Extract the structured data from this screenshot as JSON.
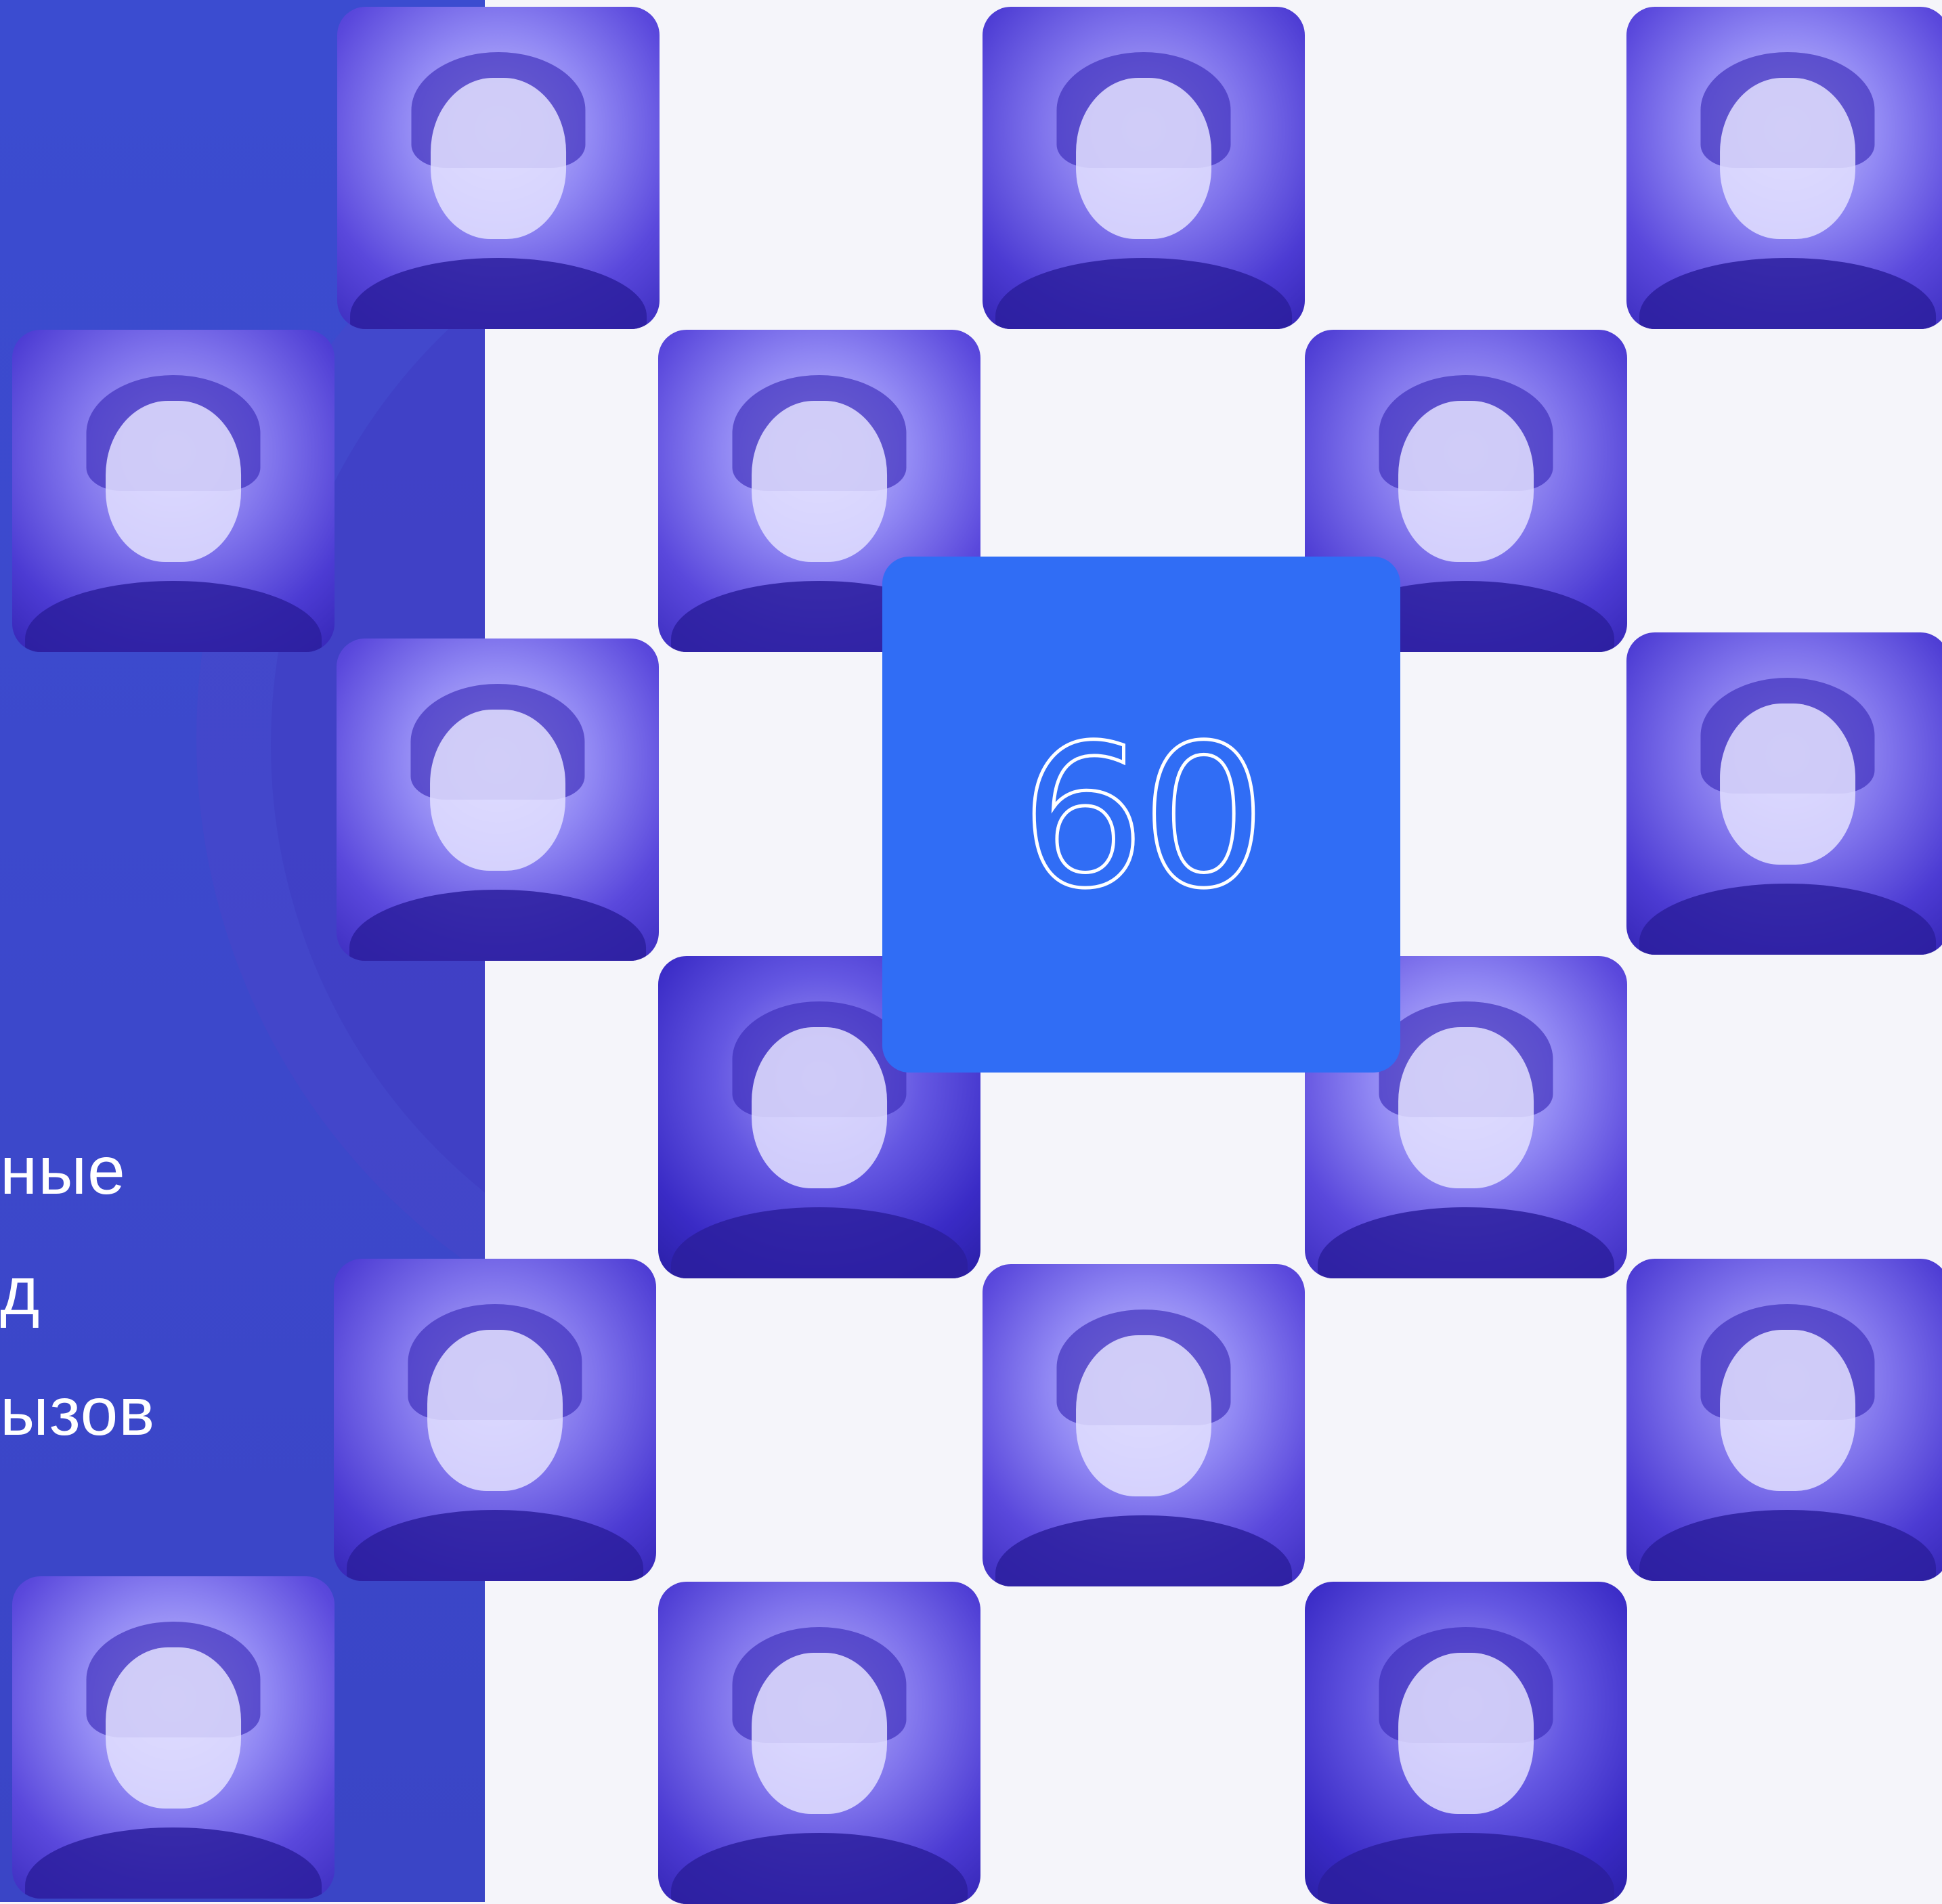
{
  "headline": {
    "line1": "ные",
    "line2": "д",
    "line3": "ызов"
  },
  "counter": "60",
  "colors": {
    "left_panel": "#3b4cd0",
    "counter_box": "#306df5",
    "page_background": "#f5f5fa"
  },
  "tiles": [
    {
      "name": "speaker-photo-1"
    },
    {
      "name": "speaker-photo-2"
    },
    {
      "name": "speaker-photo-3"
    },
    {
      "name": "speaker-photo-4"
    },
    {
      "name": "speaker-photo-5"
    },
    {
      "name": "speaker-photo-6"
    },
    {
      "name": "speaker-photo-7"
    },
    {
      "name": "speaker-photo-8"
    },
    {
      "name": "speaker-photo-9"
    },
    {
      "name": "speaker-photo-10"
    },
    {
      "name": "speaker-photo-11"
    },
    {
      "name": "speaker-photo-12"
    },
    {
      "name": "speaker-photo-13"
    },
    {
      "name": "speaker-photo-14"
    },
    {
      "name": "speaker-photo-15"
    },
    {
      "name": "speaker-photo-16"
    },
    {
      "name": "speaker-photo-17"
    }
  ]
}
